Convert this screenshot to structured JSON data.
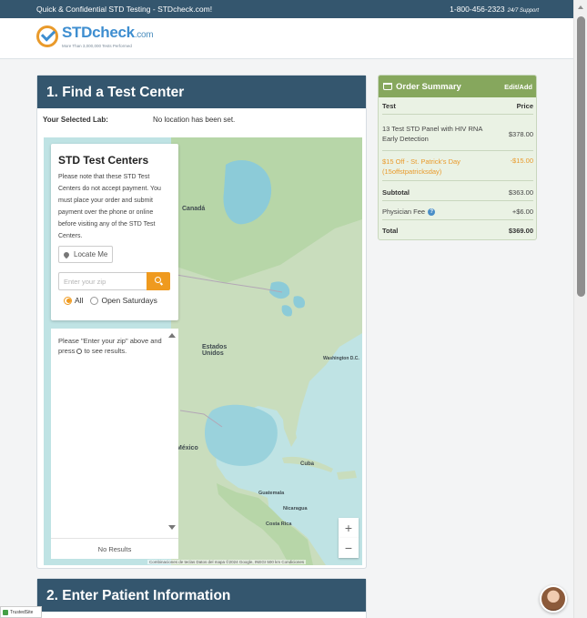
{
  "topbar": {
    "tagline": "Quick & Confidential STD Testing - STDcheck.com!",
    "phone": "1-800-456-2323",
    "support": "24/7 Support"
  },
  "logo": {
    "name": "STDcheck",
    "suffix": ".com",
    "tagline": "More Than 3,000,000 Tests Performed"
  },
  "find_center": {
    "heading": "1. Find a Test Center",
    "selected_lab_label": "Your Selected Lab:",
    "selected_lab_value": "No location has been set.",
    "finder_title": "STD Test Centers",
    "finder_note": "Please note that these STD Test Centers do not accept payment. You must place your order and submit payment over the phone or online before visiting any of the STD Test Centers.",
    "locate_me": "Locate Me",
    "zip_placeholder": "Enter your zip",
    "filter_all": "All",
    "filter_saturdays": "Open Saturdays",
    "results_hint_1": "Please \"Enter your zip\" above and press",
    "results_hint_2": "to see results.",
    "results_footer": "No Results"
  },
  "map": {
    "labels": [
      "Canadá",
      "Estados Unidos",
      "México",
      "Cuba",
      "Guatemala",
      "Nicaragua",
      "Costa Rica",
      "Washington D.C."
    ],
    "zoom_in": "+",
    "zoom_out": "−",
    "attribution": "Combinaciones de teclas   Datos del mapa ©2024 Google, INEGI   500 km   Condiciones"
  },
  "patient": {
    "heading": "2. Enter Patient Information"
  },
  "order": {
    "title": "Order Summary",
    "edit": "Edit/Add",
    "col_test": "Test",
    "col_price": "Price",
    "item_name": "13 Test STD Panel with HIV RNA Early Detection",
    "item_price": "$378.00",
    "discount_name": "$15 Off - St. Patrick's Day (15offstpatricksday)",
    "discount_price": "-$15.00",
    "subtotal_label": "Subtotal",
    "subtotal_value": "$363.00",
    "fee_label": "Physician Fee",
    "fee_value": "+$6.00",
    "total_label": "Total",
    "total_value": "$369.00"
  },
  "badges": {
    "trusted": "TrustedSite"
  },
  "colors": {
    "navy": "#34566e",
    "orange": "#ef9a1f",
    "green": "#86a75d"
  }
}
